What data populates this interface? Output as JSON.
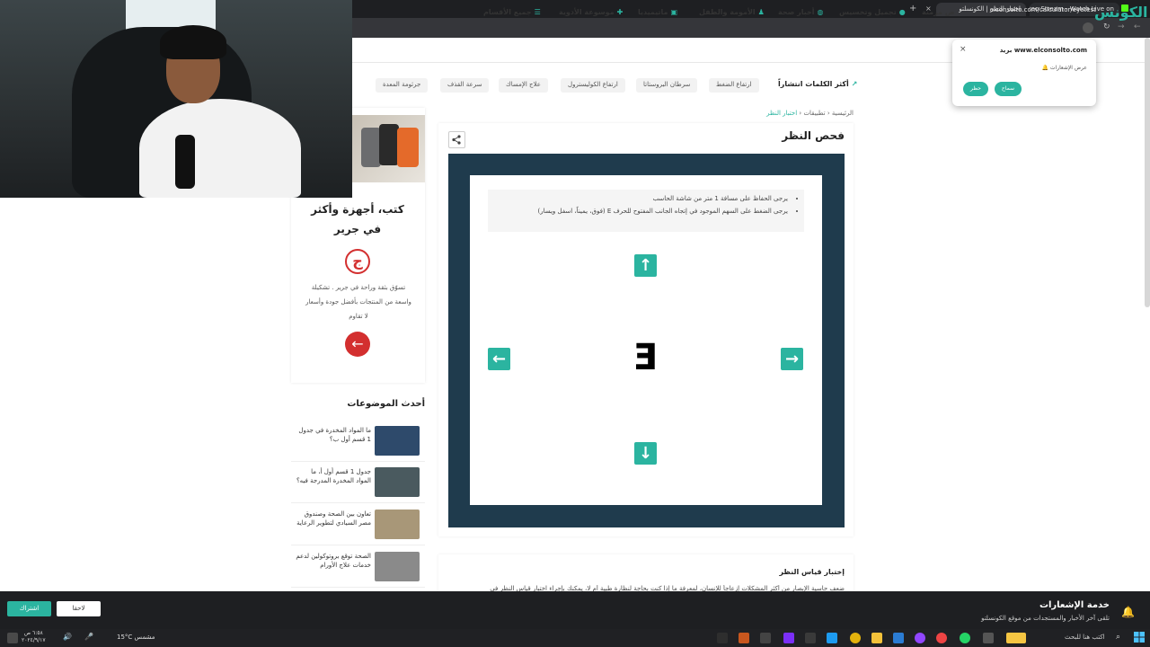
{
  "browser": {
    "tabs": [
      {
        "label": "اختبار النظر | الكونسلتو",
        "active": true
      },
      {
        "label": "iketoo Stream - Watch Live on",
        "active": false
      }
    ],
    "url": "elconsolto.com/calculator/eyetest"
  },
  "site": {
    "logo": "الكونس",
    "nav": [
      "جميع الأقسام",
      "موسوعة الأدوية",
      "ماتيميديا",
      "الأمومة والطفل",
      "أخبار صحة",
      "تجميل وتخسيس",
      "ض مزمنة"
    ],
    "trend_label": "أكثر الكلمات انتشاراً",
    "tags": [
      "ارتفاع الضغط",
      "سرطان البروستاتا",
      "ارتفاع الكوليسترول",
      "علاج الإمساك",
      "سرعة القذف",
      "جرثومة المعدة"
    ],
    "breadcrumb": {
      "home": "الرئيسية",
      "apps": "تطبيقات",
      "current": "اختبار النظر"
    }
  },
  "main": {
    "title": "فحص النظر",
    "instructions": [
      "يرجى الحفاظ على مسافة 1 متر من شاشة الحاسب",
      "يرجى الضغط على السهم الموجود في إتجاه الجانب المفتوح للحرف E (فوق، يميناً، اسفل ويسار)"
    ],
    "letter": "E",
    "arrows": {
      "up": "↑",
      "down": "↓",
      "left": "←",
      "right": "→"
    },
    "section2_title": "إختبار قياس النظر",
    "section2_text": "ضعف حاسية الإبصار من أكثر المشكلات إزعاجاً للإنسان، لمعرفة ما إذا كنت بحاجة لنظارة طبية أم لا، يمكنك بإجراء اختبار قياس النظر في"
  },
  "ad": {
    "title": "كتب، أجهزة وأكثر في جرير",
    "logo": "ج",
    "description": "تسوّق بثقة وراحة في جرير . تشكيلة واسعة من المنتجات بأفضل جودة وأسعار لا تقاوم",
    "cta": "←"
  },
  "latest": {
    "title": "أحدث الموضوعات",
    "items": [
      {
        "text": "ما المواد المخدرة في جدول 1 قسم أول ب؟",
        "thumb_color": "#2e4a6b"
      },
      {
        "text": "جدول 1 قسم أول أ، ما المواد المخدرة المدرجة فيه؟",
        "thumb_color": "#4a5a5f"
      },
      {
        "text": "تعاون بين الصحة وصندوق مصر السيادي لتطوير الرعاية",
        "thumb_color": "#a89778"
      },
      {
        "text": "الصحة توقع بروتوكولين لدعم خدمات علاج الأورام",
        "thumb_color": "#8a8a8a"
      }
    ]
  },
  "notif_popup": {
    "title": "www.elconsolto.com بريد",
    "subtitle": "عرض الإشعارات",
    "allow": "سماح",
    "block": "حظر"
  },
  "bottom_bar": {
    "title": "خدمة الإشعارات",
    "subtitle": "تلقى آخر الأخبار والمستجدات من موقع الكونسلتو",
    "subscribe": "اشتراك",
    "later": "لاحقا"
  },
  "taskbar": {
    "time": "٦:٥٨ ص",
    "date": "٢٠٢٤/٩/١٧",
    "weather": "15°C مشمس",
    "search": "اكتب هنا للبحث"
  },
  "colors": {
    "accent": "#2bb4a0",
    "frame": "#1f3b4d",
    "ad_red": "#d32f2f"
  }
}
